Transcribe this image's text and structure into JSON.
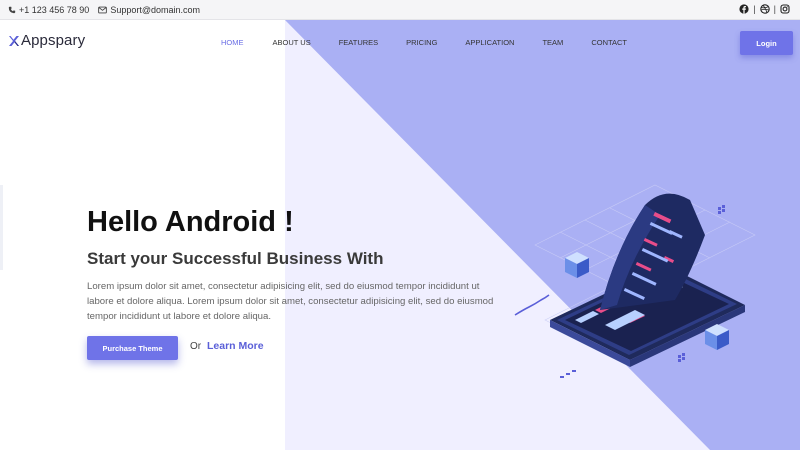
{
  "topbar": {
    "phone": "+1 123 456 78 90",
    "email": "Support@domain.com",
    "social": [
      "facebook-icon",
      "dribbble-icon",
      "instagram-icon"
    ]
  },
  "navbar": {
    "logo": "Appspary",
    "menu": [
      "HOME",
      "ABOUT US",
      "FEATURES",
      "PRICING",
      "APPLICATION",
      "TEAM",
      "CONTACT"
    ],
    "active": "HOME",
    "login": "Login"
  },
  "hero": {
    "title": "Hello Android !",
    "subtitle": "Start your Successful Business With",
    "text": "Lorem ipsum dolor sit amet, consectetur adipisicing elit, sed do eiusmod tempor incididunt ut labore et dolore aliqua. Lorem ipsum dolor sit amet, consectetur adipisicing elit, sed do eiusmod tempor incididunt ut labore et dolore aliqua.",
    "purchase_button": "Purchase Theme",
    "or": "Or",
    "learn_more": "Learn More"
  },
  "colors": {
    "accent": "#6f73e8",
    "diagonal": "#aab0f4",
    "light_panel": "#f0efff"
  }
}
